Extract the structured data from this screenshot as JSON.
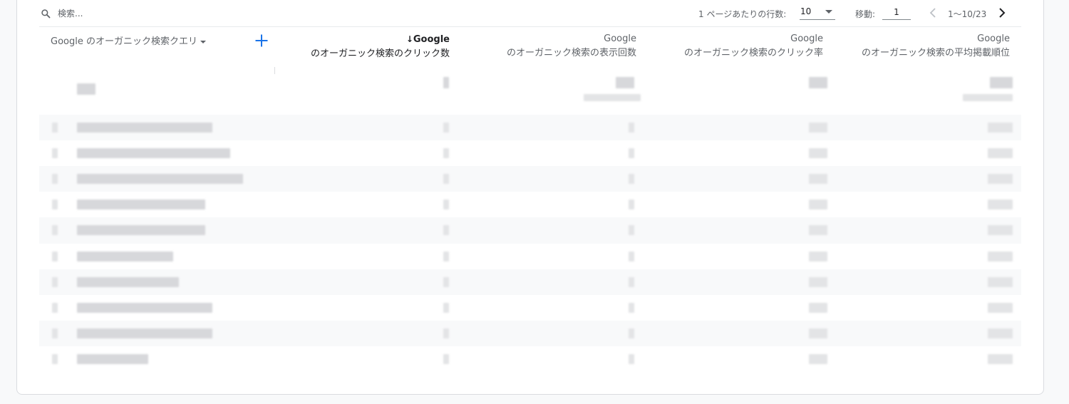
{
  "toolbar": {
    "search_placeholder": "検索...",
    "rows_per_page_label": "1 ページあたりの行数:",
    "rows_per_page_value": "10",
    "goto_label": "移動:",
    "goto_value": "1",
    "range_label": "1〜10/23"
  },
  "icons": {
    "search": "search-icon",
    "add": "add-icon",
    "prev": "chevron-left-icon",
    "next": "chevron-right-icon",
    "sort_down": "arrow-down-icon"
  },
  "colors": {
    "accent": "#1a73e8",
    "text": "#5f6368",
    "text_active": "#202124",
    "border": "#dadce0",
    "row_alt": "#f8f9fa"
  },
  "table": {
    "query_column": "Google のオーガニック検索クエリ",
    "columns": [
      {
        "line1": "Google",
        "line2": "のオーガニック検索のクリック数",
        "sorted": true,
        "sort_arrow": "↓"
      },
      {
        "line1": "Google",
        "line2": "のオーガニック検索の表示回数",
        "sorted": false,
        "sort_arrow": ""
      },
      {
        "line1": "Google",
        "line2": "のオーガニック検索のクリック率",
        "sorted": false,
        "sort_arrow": ""
      },
      {
        "line1": "Google",
        "line2": "のオーガニック検索の平均掲載順位",
        "sorted": false,
        "sort_arrow": ""
      }
    ],
    "row_count": 10
  }
}
